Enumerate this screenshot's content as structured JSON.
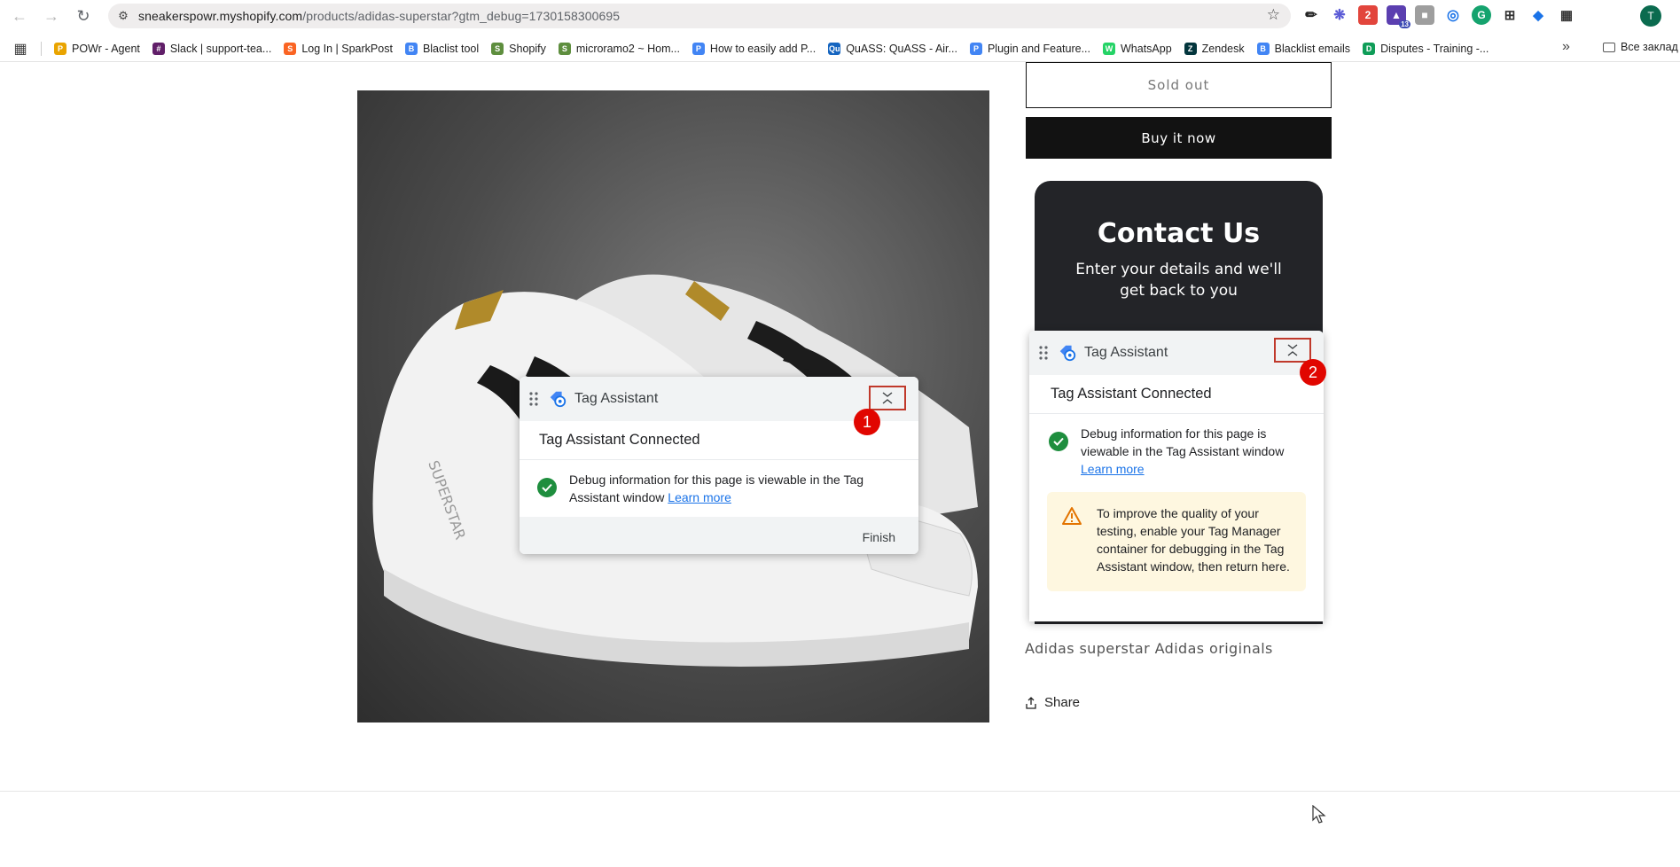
{
  "browser": {
    "url_host": "sneakerspowr.myshopify.com",
    "url_path": "/products/adidas-superstar?gtm_debug=1730158300695",
    "profile_initial": "T",
    "extension_badge": "13",
    "bookmarks": [
      {
        "label": "POWr - Agent",
        "color": "#e9a400",
        "glyph": "P"
      },
      {
        "label": "Slack | support-tea...",
        "color": "#611f69",
        "glyph": "#"
      },
      {
        "label": "Log In | SparkPost",
        "color": "#fa6423",
        "glyph": "S"
      },
      {
        "label": "Blaclist tool",
        "color": "#4285f4",
        "glyph": "B"
      },
      {
        "label": "Shopify",
        "color": "#5e8e3e",
        "glyph": "S"
      },
      {
        "label": "microramo2 ~ Hom...",
        "color": "#5e8e3e",
        "glyph": "S"
      },
      {
        "label": "How to easily add P...",
        "color": "#4285f4",
        "glyph": "P"
      },
      {
        "label": "QuASS: QuASS - Air...",
        "color": "#1565c0",
        "glyph": "Qu"
      },
      {
        "label": "Plugin and Feature...",
        "color": "#4285f4",
        "glyph": "P"
      },
      {
        "label": "WhatsApp",
        "color": "#25d366",
        "glyph": "W"
      },
      {
        "label": "Zendesk",
        "color": "#03363d",
        "glyph": "Z"
      },
      {
        "label": "Blacklist emails",
        "color": "#4285f4",
        "glyph": "B"
      },
      {
        "label": "Disputes - Training -...",
        "color": "#0f9d58",
        "glyph": "D"
      }
    ],
    "bookmarks_more": "»",
    "other_bookmarks": "Все заклад"
  },
  "product": {
    "sold_out_label": "Sold out",
    "buy_now_label": "Buy it now",
    "description": "Adidas superstar Adidas originals",
    "share_label": "Share"
  },
  "contact": {
    "title": "Contact Us",
    "subtitle": "Enter your details and we'll get back to you"
  },
  "tag_assistant_1": {
    "title": "Tag Assistant",
    "marker": "1",
    "connected": "Tag Assistant Connected",
    "message": "Debug information for this page is viewable in the Tag Assistant window",
    "learn_more": "Learn more",
    "finish": "Finish"
  },
  "tag_assistant_2": {
    "title": "Tag Assistant",
    "marker": "2",
    "connected": "Tag Assistant Connected",
    "message": "Debug information for this page is viewable in the Tag Assistant window",
    "learn_more": "Learn more",
    "warning": "To improve the quality of your testing, enable your Tag Manager container for debugging in the Tag Assistant window, then return here."
  }
}
